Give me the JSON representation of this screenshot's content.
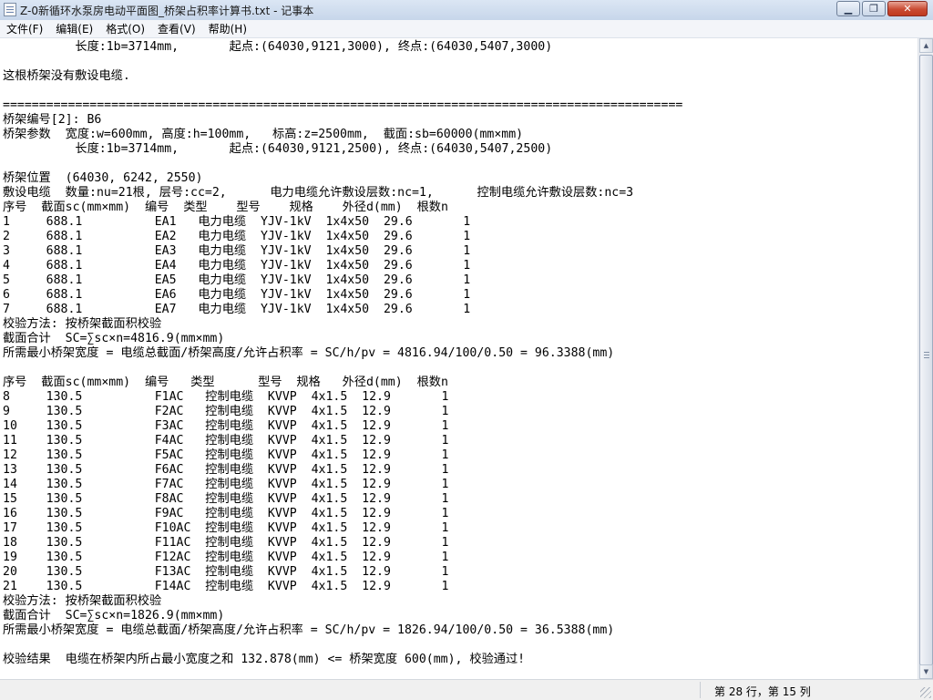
{
  "window": {
    "title": "Z-0新循环水泵房电动平面图_桥架占积率计算书.txt - 记事本",
    "minimize_symbol": "▁",
    "maximize_symbol": "❐",
    "close_symbol": "✕"
  },
  "menu": [
    "文件(F)",
    "编辑(E)",
    "格式(O)",
    "查看(V)",
    "帮助(H)"
  ],
  "document": {
    "lines": [
      "          长度:1b=3714mm,       起点:(64030,9121,3000), 终点:(64030,5407,3000)",
      "",
      "这根桥架没有敷设电缆.",
      "",
      "==============================================================================================",
      "桥架编号[2]: B6",
      "桥架参数  宽度:w=600mm, 高度:h=100mm,   标高:z=2500mm,  截面:sb=60000(mm×mm)",
      "          长度:1b=3714mm,       起点:(64030,9121,2500), 终点:(64030,5407,2500)",
      "",
      "桥架位置  (64030, 6242, 2550)",
      "敷设电缆  数量:nu=21根, 层号:cc=2,      电力电缆允许敷设层数:nc=1,      控制电缆允许敷设层数:nc=3",
      "序号  截面sc(mm×mm)  编号  类型    型号    规格    外径d(mm)  根数n",
      "1     688.1          EA1   电力电缆  YJV-1kV  1x4x50  29.6       1",
      "2     688.1          EA2   电力电缆  YJV-1kV  1x4x50  29.6       1",
      "3     688.1          EA3   电力电缆  YJV-1kV  1x4x50  29.6       1",
      "4     688.1          EA4   电力电缆  YJV-1kV  1x4x50  29.6       1",
      "5     688.1          EA5   电力电缆  YJV-1kV  1x4x50  29.6       1",
      "6     688.1          EA6   电力电缆  YJV-1kV  1x4x50  29.6       1",
      "7     688.1          EA7   电力电缆  YJV-1kV  1x4x50  29.6       1",
      "校验方法: 按桥架截面积校验",
      "截面合计  SC=∑sc×n=4816.9(mm×mm)",
      "所需最小桥架宽度 = 电缆总截面/桥架高度/允许占积率 = SC/h/pv = 4816.94/100/0.50 = 96.3388(mm)",
      "",
      "序号  截面sc(mm×mm)  编号   类型      型号  规格   外径d(mm)  根数n",
      "8     130.5          F1AC   控制电缆  KVVP  4x1.5  12.9       1",
      "9     130.5          F2AC   控制电缆  KVVP  4x1.5  12.9       1",
      "10    130.5          F3AC   控制电缆  KVVP  4x1.5  12.9       1",
      "11    130.5          F4AC   控制电缆  KVVP  4x1.5  12.9       1",
      "12    130.5          F5AC   控制电缆  KVVP  4x1.5  12.9       1",
      "13    130.5          F6AC   控制电缆  KVVP  4x1.5  12.9       1",
      "14    130.5          F7AC   控制电缆  KVVP  4x1.5  12.9       1",
      "15    130.5          F8AC   控制电缆  KVVP  4x1.5  12.9       1",
      "16    130.5          F9AC   控制电缆  KVVP  4x1.5  12.9       1",
      "17    130.5          F10AC  控制电缆  KVVP  4x1.5  12.9       1",
      "18    130.5          F11AC  控制电缆  KVVP  4x1.5  12.9       1",
      "19    130.5          F12AC  控制电缆  KVVP  4x1.5  12.9       1",
      "20    130.5          F13AC  控制电缆  KVVP  4x1.5  12.9       1",
      "21    130.5          F14AC  控制电缆  KVVP  4x1.5  12.9       1",
      "校验方法: 按桥架截面积校验",
      "截面合计  SC=∑sc×n=1826.9(mm×mm)",
      "所需最小桥架宽度 = 电缆总截面/桥架高度/允许占积率 = SC/h/pv = 1826.94/100/0.50 = 36.5388(mm)",
      "",
      "校验结果  电缆在桥架内所占最小宽度之和 132.878(mm) <= 桥架宽度 600(mm), 校验通过!"
    ]
  },
  "status": {
    "position": "第 28 行，第 15 列"
  }
}
